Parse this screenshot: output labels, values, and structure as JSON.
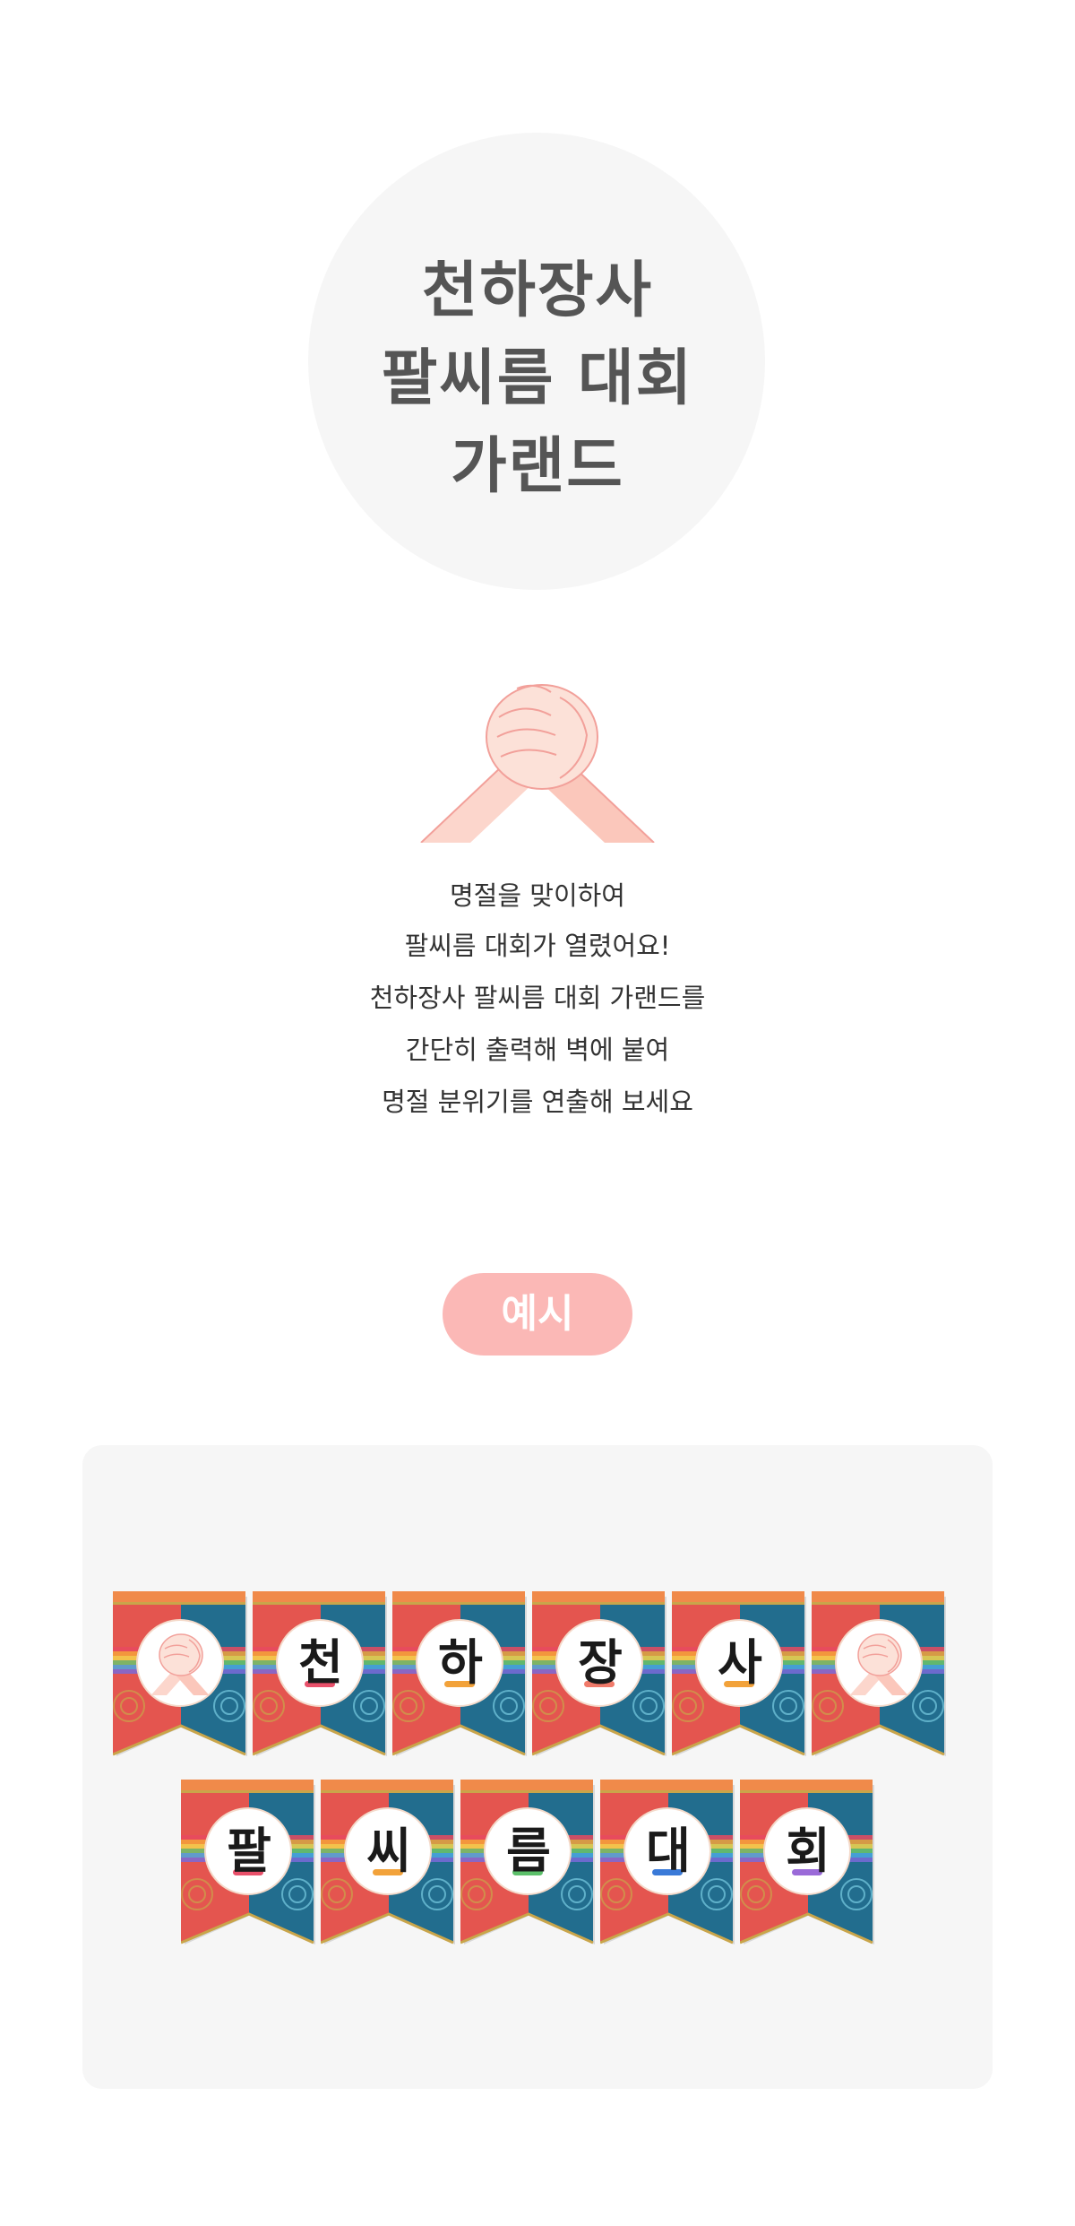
{
  "title": {
    "lines": [
      "천하장사",
      "팔씨름 대회",
      "가랜드"
    ]
  },
  "description": {
    "lines": [
      "명절을 맞이하여",
      "팔씨름 대회가 열렸어요!",
      "천하장사 팔씨름 대회 가랜드를",
      "간단히 출력해 벽에 붙여",
      "명절 분위기를 연출해 보세요"
    ]
  },
  "example": {
    "label": "예시"
  },
  "garland": {
    "row1": [
      {
        "type": "icon",
        "icon": "clasped-hands-icon",
        "accent": "#f7a7a2"
      },
      {
        "type": "letter",
        "letter": "천",
        "accent": "#e8506a"
      },
      {
        "type": "letter",
        "letter": "하",
        "accent": "#f2a23a"
      },
      {
        "type": "letter",
        "letter": "장",
        "accent": "#f07a6a"
      },
      {
        "type": "letter",
        "letter": "사",
        "accent": "#f2a23a"
      },
      {
        "type": "icon",
        "icon": "clasped-hands-icon",
        "accent": "#f7a7a2"
      }
    ],
    "row2": [
      {
        "type": "letter",
        "letter": "팔",
        "accent": "#e8506a"
      },
      {
        "type": "letter",
        "letter": "씨",
        "accent": "#f2a23a"
      },
      {
        "type": "letter",
        "letter": "름",
        "accent": "#5cc06a"
      },
      {
        "type": "letter",
        "letter": "대",
        "accent": "#3a7ad8"
      },
      {
        "type": "letter",
        "letter": "회",
        "accent": "#9a6ad8"
      }
    ]
  },
  "colors": {
    "flag_red": "#e4554f",
    "flag_blue": "#226d8e",
    "flag_top": "#f08a4a",
    "flag_gold": "#c9a54a",
    "circle_bg": "#f6f6f6",
    "pill": "#fbb8b6"
  }
}
